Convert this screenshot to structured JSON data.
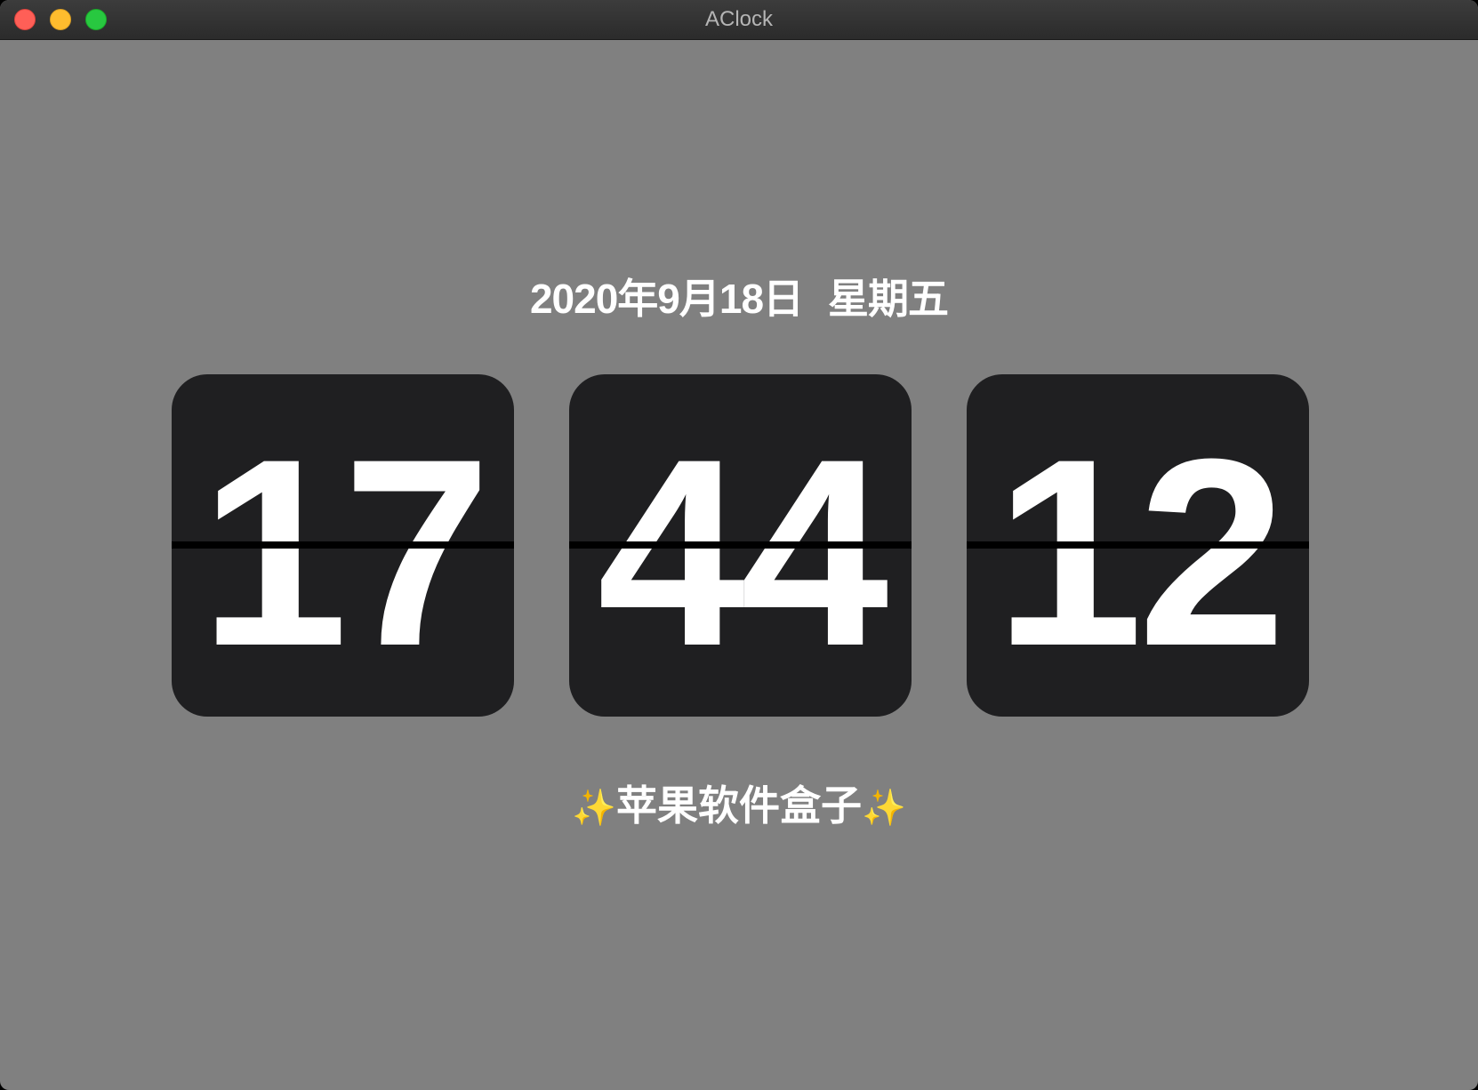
{
  "window": {
    "title": "AClock"
  },
  "date": {
    "date_text": "2020年9月18日",
    "weekday": "星期五"
  },
  "clock": {
    "hours": "17",
    "minutes": "44",
    "seconds": "12"
  },
  "tagline": {
    "sparkle_left": "✨",
    "text": "苹果软件盒子",
    "sparkle_right": "✨"
  },
  "colors": {
    "background": "#808080",
    "card": "#1f1f21",
    "digits": "#ffffff",
    "close": "#ff5f57",
    "minimize": "#febc2e",
    "maximize": "#28c840"
  }
}
